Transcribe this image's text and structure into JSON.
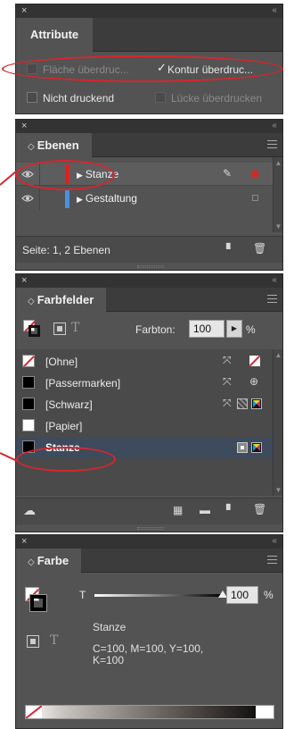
{
  "attribute_panel": {
    "tab": "Attribute",
    "flaeche_label": "Fläche überdruc...",
    "kontur_label": "Kontur überdruc...",
    "nicht_druckend_label": "Nicht druckend",
    "luecke_label": "Lücke überdrucken"
  },
  "ebenen_panel": {
    "tab": "Ebenen",
    "layers": [
      {
        "name": "Stanze",
        "color": "#e0221f"
      },
      {
        "name": "Gestaltung",
        "color": "#4a90e2"
      }
    ],
    "footer_status": "Seite: 1, 2 Ebenen"
  },
  "farbfelder_panel": {
    "tab": "Farbfelder",
    "tint_label": "Farbton:",
    "tint_value": "100",
    "tint_unit": "%",
    "swatches": [
      {
        "name": "[Ohne]"
      },
      {
        "name": "[Passermarken]"
      },
      {
        "name": "[Schwarz]"
      },
      {
        "name": "[Papier]"
      },
      {
        "name": "Stanze"
      }
    ]
  },
  "farbe_panel": {
    "tab": "Farbe",
    "tint_label": "T",
    "tint_value": "100",
    "tint_unit": "%",
    "swatch_name": "Stanze",
    "cmyk_line1": "C=100, M=100, Y=100,",
    "cmyk_line2": "K=100"
  },
  "colors": {
    "annotation_red": "#d7262e",
    "selection_blue": "#3d4b5c",
    "panel_gray": "#535353"
  }
}
